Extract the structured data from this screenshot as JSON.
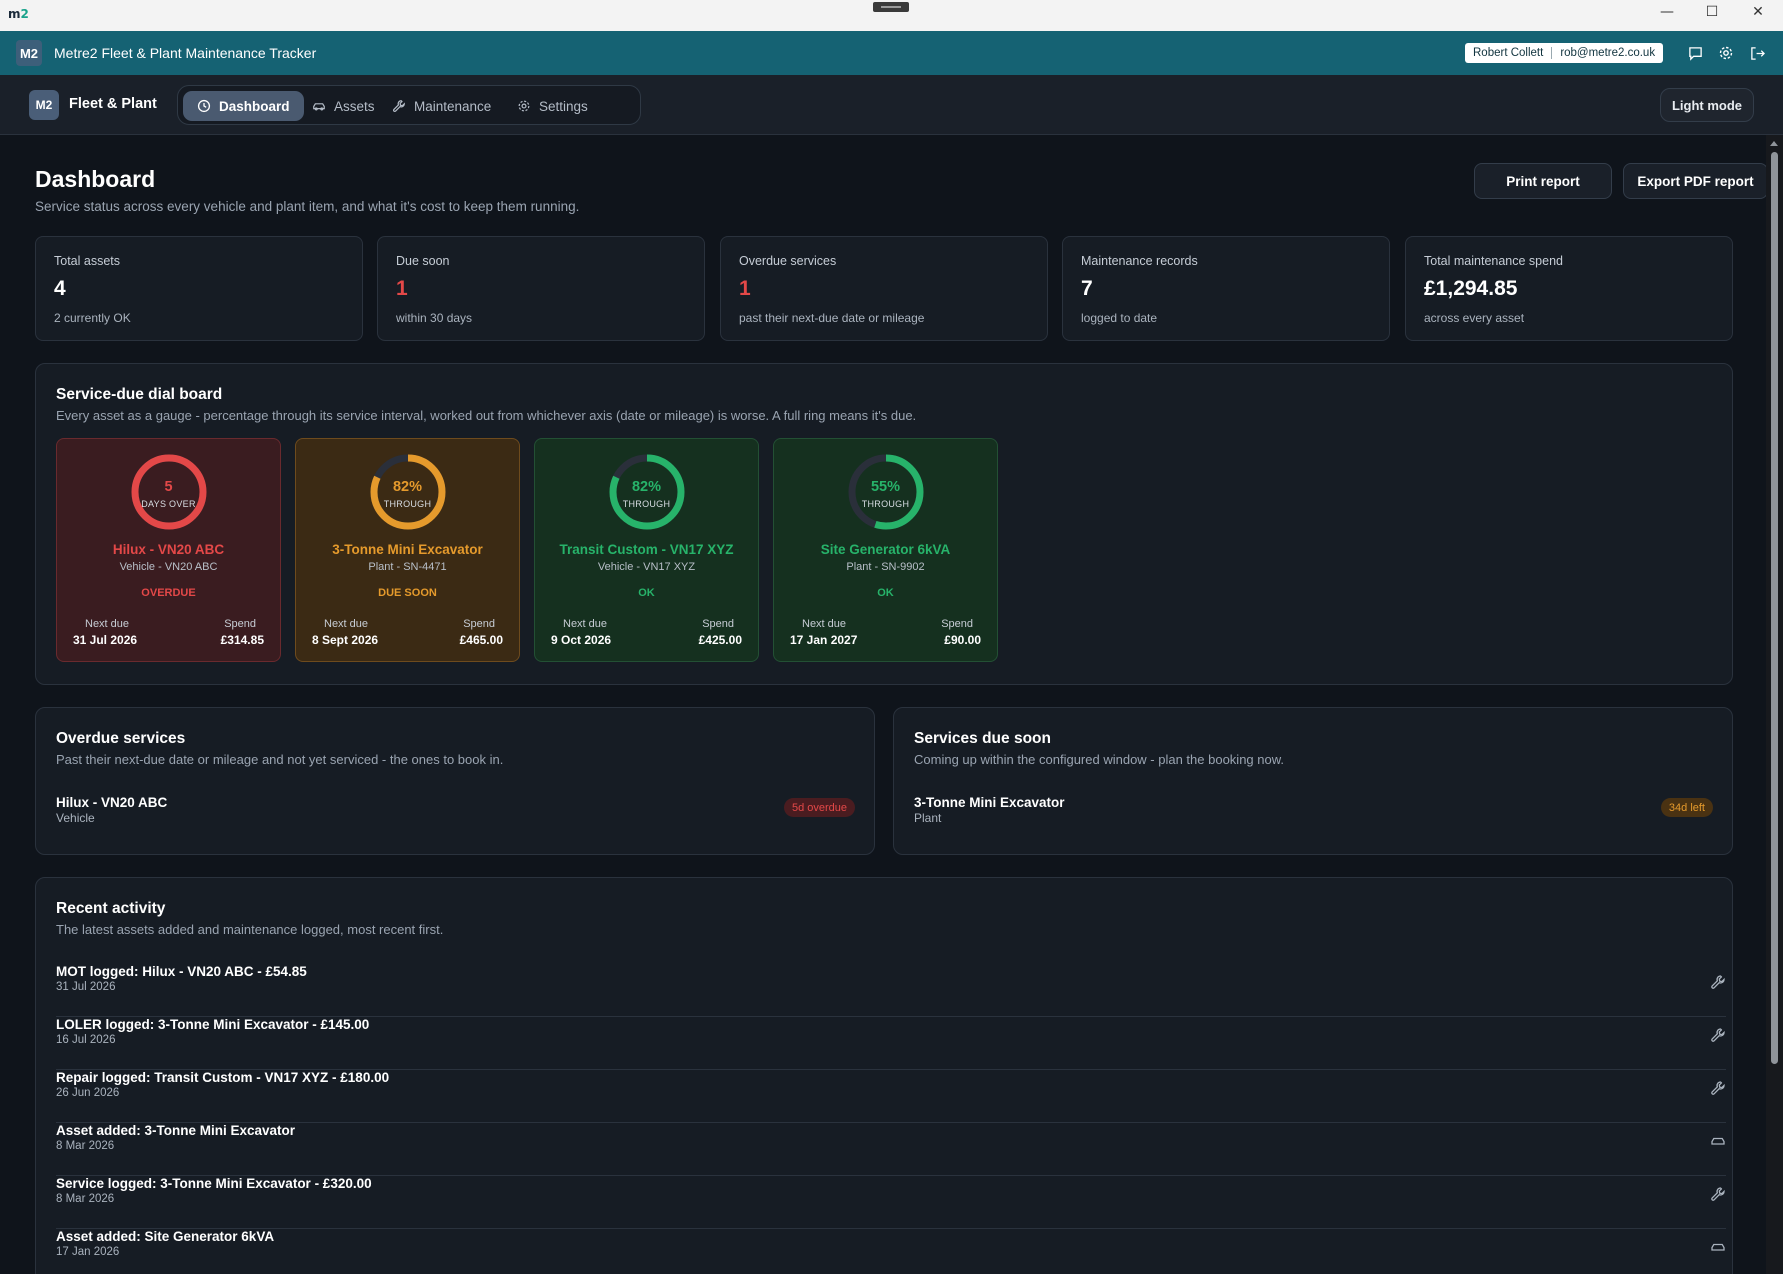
{
  "window": {
    "logo_main": "m",
    "logo_accent": "2",
    "minimize": "—",
    "maximize": "☐",
    "close": "✕"
  },
  "appbar": {
    "badge": "M2",
    "title": "Metre2 Fleet & Plant Maintenance Tracker",
    "user_name": "Robert Collett",
    "user_email": "rob@metre2.co.uk"
  },
  "navbar": {
    "badge": "M2",
    "brand": "Fleet & Plant",
    "tabs": [
      {
        "label": "Dashboard",
        "icon": "clock-icon",
        "active": true
      },
      {
        "label": "Assets",
        "icon": "car-icon",
        "active": false
      },
      {
        "label": "Maintenance",
        "icon": "wrench-icon",
        "active": false
      },
      {
        "label": "Settings",
        "icon": "gear-icon",
        "active": false
      }
    ],
    "light_mode": "Light mode"
  },
  "header": {
    "title": "Dashboard",
    "subtitle": "Service status across every vehicle and plant item, and what it's cost to keep them running.",
    "print": "Print report",
    "export": "Export PDF report"
  },
  "stats": [
    {
      "label": "Total assets",
      "value": "4",
      "sub": "2 currently OK",
      "accent": false
    },
    {
      "label": "Due soon",
      "value": "1",
      "sub": "within 30 days",
      "accent": true
    },
    {
      "label": "Overdue services",
      "value": "1",
      "sub": "past their next-due date or mileage",
      "accent": true
    },
    {
      "label": "Maintenance records",
      "value": "7",
      "sub": "logged to date",
      "accent": false
    },
    {
      "label": "Total maintenance spend",
      "value": "£1,294.85",
      "sub": "across every asset",
      "accent": false
    }
  ],
  "dialboard": {
    "title": "Service-due dial board",
    "desc": "Every asset as a gauge - percentage through its service interval, worked out from whichever axis (date or mileage) is worse. A full ring means it's due.",
    "next_label": "Next due",
    "spend_label": "Spend",
    "dials": [
      {
        "value": "5",
        "unit": "DAYS OVER",
        "progress": 1.0,
        "name": "Hilux - VN20 ABC",
        "type": "Vehicle - VN20 ABC",
        "status": "OVERDUE",
        "next": "31 Jul 2026",
        "spend": "£314.85",
        "color": "#e34848"
      },
      {
        "value": "82%",
        "unit": "THROUGH",
        "progress": 0.82,
        "name": "3-Tonne Mini Excavator",
        "type": "Plant - SN-4471",
        "status": "DUE SOON",
        "next": "8 Sept 2026",
        "spend": "£465.00",
        "color": "#e59a2c"
      },
      {
        "value": "82%",
        "unit": "THROUGH",
        "progress": 0.82,
        "name": "Transit Custom - VN17 XYZ",
        "type": "Vehicle - VN17 XYZ",
        "status": "OK",
        "next": "9 Oct 2026",
        "spend": "£425.00",
        "color": "#27b36a"
      },
      {
        "value": "55%",
        "unit": "THROUGH",
        "progress": 0.55,
        "name": "Site Generator 6kVA",
        "type": "Plant - SN-9902",
        "status": "OK",
        "next": "17 Jan 2027",
        "spend": "£90.00",
        "color": "#27b36a"
      }
    ]
  },
  "overdue": {
    "title": "Overdue services",
    "desc": "Past their next-due date or mileage and not yet serviced - the ones to book in.",
    "items": [
      {
        "name": "Hilux - VN20 ABC",
        "type": "Vehicle",
        "badge": "5d overdue"
      }
    ]
  },
  "duesoon": {
    "title": "Services due soon",
    "desc": "Coming up within the configured window - plan the booking now.",
    "items": [
      {
        "name": "3-Tonne Mini Excavator",
        "type": "Plant",
        "badge": "34d left"
      }
    ]
  },
  "activity": {
    "title": "Recent activity",
    "desc": "The latest assets added and maintenance logged, most recent first.",
    "items": [
      {
        "text": "MOT logged: Hilux - VN20 ABC - £54.85",
        "date": "31 Jul 2026",
        "icon": "wrench-icon"
      },
      {
        "text": "LOLER logged: 3-Tonne Mini Excavator - £145.00",
        "date": "16 Jul 2026",
        "icon": "wrench-icon"
      },
      {
        "text": "Repair logged: Transit Custom - VN17 XYZ - £180.00",
        "date": "26 Jun 2026",
        "icon": "wrench-icon"
      },
      {
        "text": "Asset added: 3-Tonne Mini Excavator",
        "date": "8 Mar 2026",
        "icon": "vehicle-icon"
      },
      {
        "text": "Service logged: 3-Tonne Mini Excavator - £320.00",
        "date": "8 Mar 2026",
        "icon": "wrench-icon"
      },
      {
        "text": "Asset added: Site Generator 6kVA",
        "date": "17 Jan 2026",
        "icon": "vehicle-icon"
      }
    ]
  }
}
